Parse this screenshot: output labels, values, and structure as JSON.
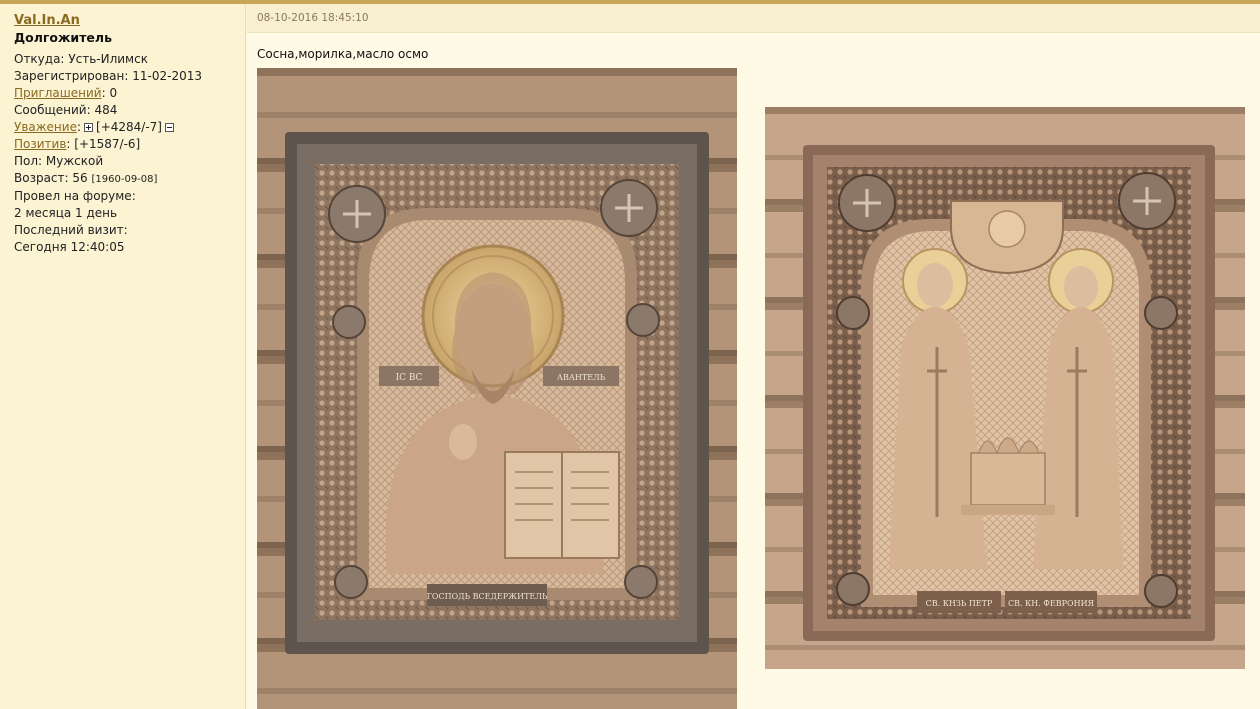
{
  "user": {
    "username": "Val.In.An",
    "rank": "Долгожитель",
    "location_label": "Откуда:",
    "location": "Усть-Илимск",
    "registered_label": "Зарегистрирован:",
    "registered": "11-02-2013",
    "invites_label": "Приглашений",
    "invites": "0",
    "posts_label": "Сообщений:",
    "posts": "484",
    "respect_label": "Уважение",
    "respect": "[+4284/-7]",
    "positive_label": "Позитив",
    "positive": "[+1587/-6]",
    "gender_label": "Пол:",
    "gender": "Мужской",
    "age_label": "Возраст:",
    "age": "56",
    "birthdate": "[1960-09-08]",
    "forum_time_label": "Провел на форуме:",
    "forum_time": "2 месяца 1 день",
    "last_visit_label": "Последний визит:",
    "last_visit": "Сегодня 12:40:05"
  },
  "post": {
    "timestamp": "08-10-2016 18:45:10",
    "text": "Сосна,морилка,масло осмо",
    "icon1_left": "ІС ВС",
    "icon1_right": "АВАНТЕЛЬ",
    "icon1_caption": "ГОСПОДЬ ВСЕДЕРЖИТЕЛЬ",
    "icon2_caption_left": "СВ. КНЗЬ ПЕТР",
    "icon2_caption_right": "СВ. КН. ФЕВРОНИЯ"
  },
  "colors": {
    "link": "#8a6a22",
    "sidebar_bg": "#fbf3d2",
    "content_bg": "#fefae6",
    "wood_light": "#c9a98a",
    "wood_dark": "#6e5a4a"
  }
}
